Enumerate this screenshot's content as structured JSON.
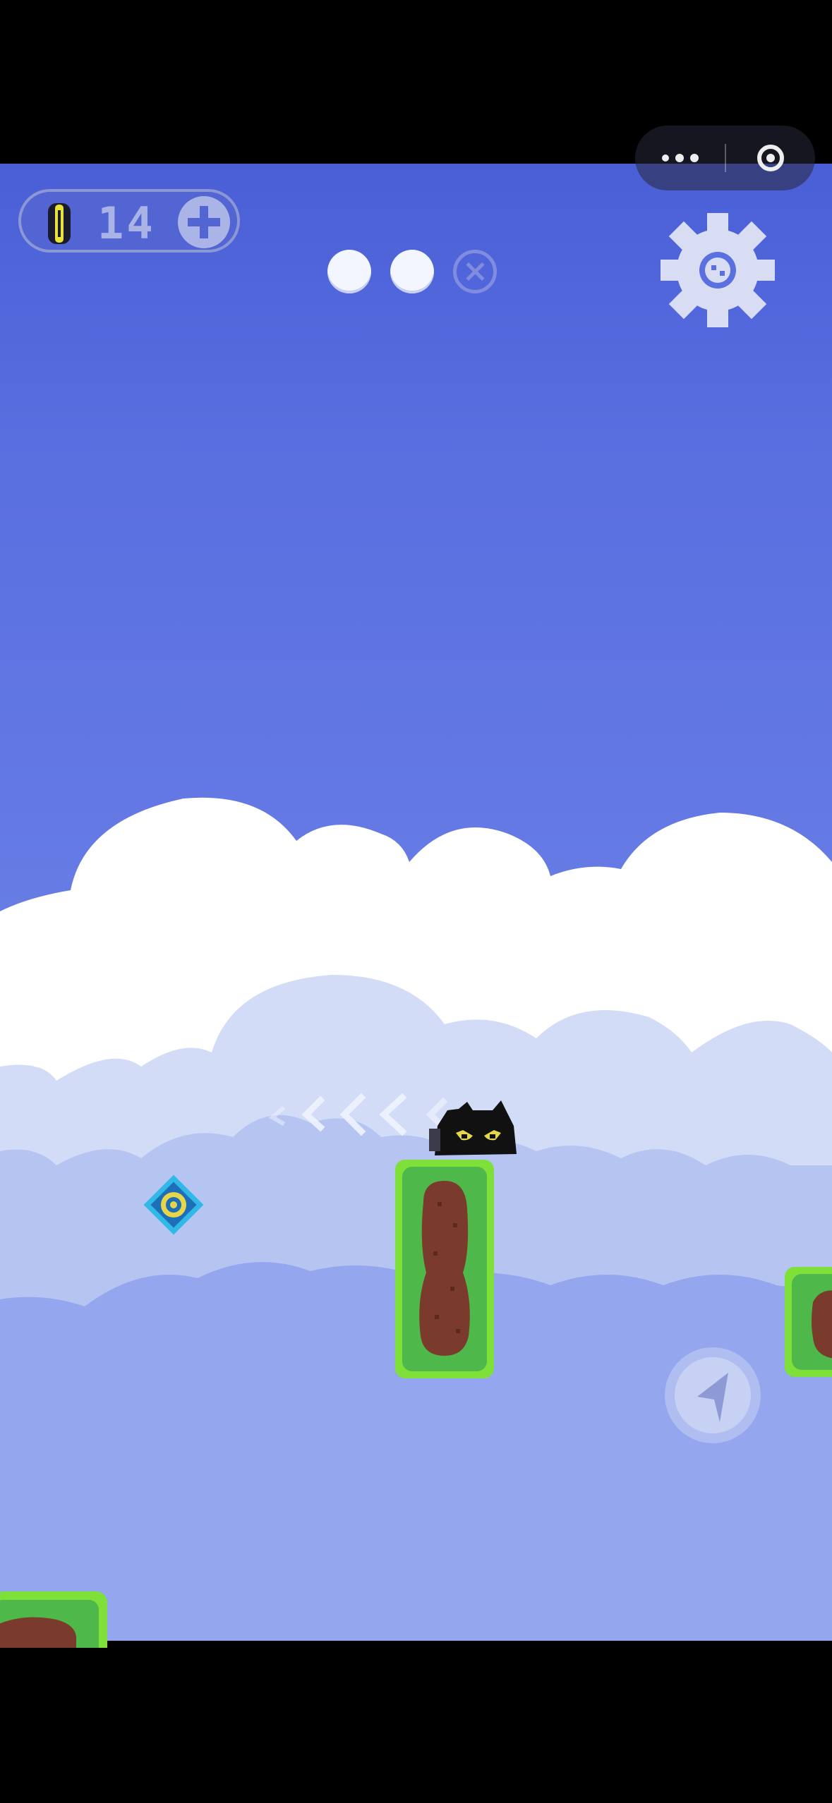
{
  "hud": {
    "coins": "14",
    "lives": [
      {
        "state": "full"
      },
      {
        "state": "full"
      },
      {
        "state": "empty"
      }
    ]
  },
  "icons": {
    "coin": "coin-icon",
    "add": "plus-icon",
    "settings": "gear-icon",
    "more": "more-dots-icon",
    "close": "target-circle-icon",
    "jump": "arrow-pointer-icon",
    "objective": "diamond-target-icon"
  },
  "colors": {
    "sky_top": "#4a5fd6",
    "sky_bottom": "#8aa0ee",
    "platform_grass": "#7fe03a",
    "platform_dirt": "#7a3b2c",
    "player": "#111111",
    "player_eyes": "#e8d64a",
    "objective": "#2fb8e8"
  }
}
